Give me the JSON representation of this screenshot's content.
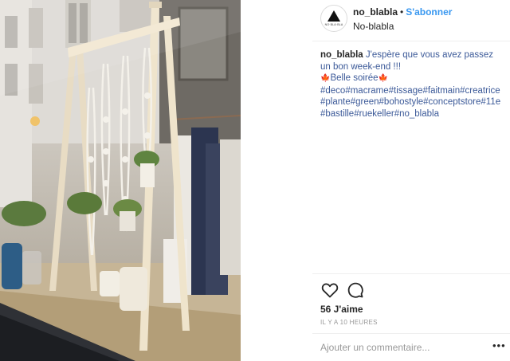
{
  "post": {
    "image_alt": "Shop window with macramé plant hangers on a wooden rack",
    "user": {
      "username": "no_blabla",
      "avatar_text": "NO·BLA·BLA",
      "follow_label": "S'abonner",
      "separator": "•",
      "display_name": "No-blabla"
    },
    "caption": {
      "username": "no_blabla",
      "line1": "J'espère que vous avez passez",
      "line2": "un bon week-end !!!",
      "line3_emoji": "🍁",
      "line3_text": "Belle soirée",
      "tags_line1": "#deco#macrame#tissage#faitmain#creatrice",
      "tags_line2": "#plante#green#bohostyle#conceptstore#11e",
      "tags_line3": "#bastille#ruekeller#no_blabla"
    },
    "likes": "56 J'aime",
    "time": "IL Y A 10 HEURES",
    "comment_placeholder": "Ajouter un commentaire...",
    "more_label": "•••"
  },
  "colors": {
    "link": "#3897f0",
    "hashtag": "#3b5998",
    "text": "#262626",
    "muted": "#999999",
    "separator": "#efefef"
  },
  "icons": [
    "heart-icon",
    "comment-icon",
    "more-options-icon"
  ]
}
